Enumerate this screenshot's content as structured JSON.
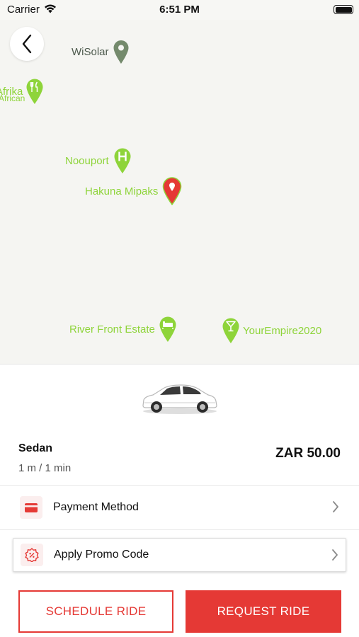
{
  "status_bar": {
    "carrier": "Carrier",
    "time": "6:51 PM",
    "wifi_icon": "wifi-icon",
    "battery_icon": "battery-icon"
  },
  "map": {
    "back_icon": "chevron-left-icon",
    "pois": [
      {
        "label": "WiSolar",
        "icon": "map-pin-icon",
        "color": "#748a6c"
      },
      {
        "label": "Afrika",
        "sub": "African",
        "icon": "restaurant-pin-icon",
        "color": "#8ed43a"
      },
      {
        "label": "Noouport",
        "icon": "hospital-pin-icon",
        "color": "#8ed43a"
      },
      {
        "label": "Hakuna Mipaks",
        "icon": "selected-location-pin-icon",
        "color": "#e53935"
      },
      {
        "label": "River Front Estate",
        "icon": "hotel-pin-icon",
        "color": "#8ed43a"
      },
      {
        "label": "YourEmpire2020",
        "icon": "bar-pin-icon",
        "color": "#8ed43a"
      }
    ]
  },
  "vehicle": {
    "image": "sedan-car-icon",
    "name": "Sedan",
    "eta": "1 m / 1 min",
    "price": "ZAR 50.00"
  },
  "options": {
    "payment": {
      "label": "Payment Method",
      "icon": "credit-card-icon"
    },
    "promo": {
      "label": "Apply Promo Code",
      "icon": "discount-badge-icon"
    }
  },
  "actions": {
    "schedule_label": "SCHEDULE RIDE",
    "request_label": "REQUEST RIDE"
  },
  "colors": {
    "accent": "#e53935",
    "poi_green": "#8ed43a",
    "map_background": "#f5f5f2"
  }
}
